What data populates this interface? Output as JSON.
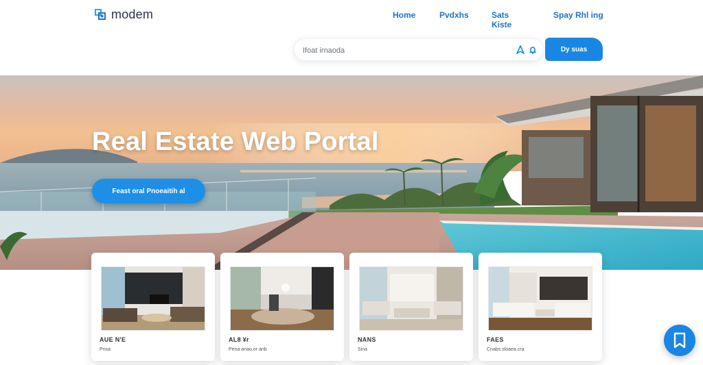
{
  "brand": {
    "name": "modem"
  },
  "nav": {
    "items": [
      "Home",
      "Pvdxhs",
      "Sats Kiste",
      "Spay Rhl ing"
    ]
  },
  "search": {
    "placeholder": "Ifoat irnaoda",
    "button_label": "Dy suas"
  },
  "hero": {
    "title": "Real Estate Web Portal",
    "cta_label": "Feast oral Pnoeaitih al"
  },
  "listings": [
    {
      "title": "AUE N'E",
      "subtitle": "Pnsa"
    },
    {
      "title": "AL8 ¥r",
      "subtitle": "Pena anao.or anb"
    },
    {
      "title": "NANS",
      "subtitle": "Sina"
    },
    {
      "title": "FAES",
      "subtitle": "Cnabs sloaea.cra"
    }
  ],
  "colors": {
    "accent": "#1a86e4",
    "nav_text": "#1d72c9",
    "logo_text": "#2a3340"
  },
  "icons": {
    "logo": "modem-logo-icon",
    "search_a": "pin-icon",
    "search_b": "bell-icon",
    "fab": "bookmark-icon"
  }
}
